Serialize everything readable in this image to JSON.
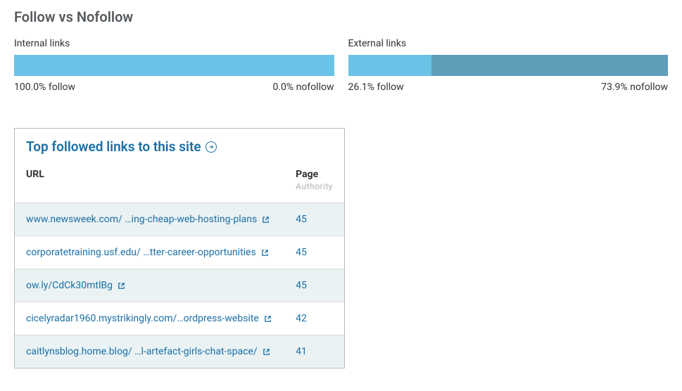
{
  "section_title": "Follow vs Nofollow",
  "chart_data": [
    {
      "type": "bar",
      "title": "Internal links",
      "categories": [
        "follow",
        "nofollow"
      ],
      "values": [
        100.0,
        0.0
      ],
      "follow_label": "100.0% follow",
      "nofollow_label": "0.0% nofollow"
    },
    {
      "type": "bar",
      "title": "External links",
      "categories": [
        "follow",
        "nofollow"
      ],
      "values": [
        26.1,
        73.9
      ],
      "follow_label": "26.1% follow",
      "nofollow_label": "73.9% nofollow"
    }
  ],
  "card": {
    "title": "Top followed links to this site",
    "columns": {
      "url": "URL",
      "page": "Page",
      "page_sub": "Authority"
    },
    "rows": [
      {
        "url": "www.newsweek.com/ …ing-cheap-web-hosting-plans",
        "page": "45"
      },
      {
        "url": "corporatetraining.usf.edu/ …tter-career-opportunities",
        "page": "45"
      },
      {
        "url": "ow.ly/CdCk30mtlBg",
        "page": "45"
      },
      {
        "url": "cicelyradar1960.mystrikingly.com/…ordpress-website",
        "page": "42"
      },
      {
        "url": "caitlynsblog.home.blog/ …l-artefact-girls-chat-space/",
        "page": "41"
      }
    ]
  }
}
